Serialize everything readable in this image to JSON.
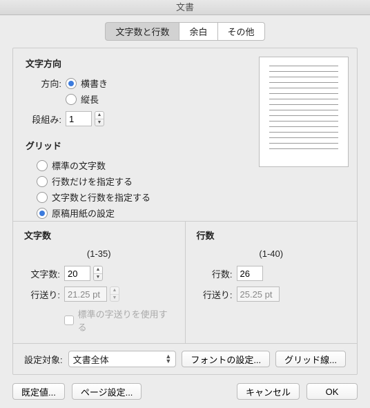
{
  "title": "文書",
  "tabs": {
    "t0": "文字数と行数",
    "t1": "余白",
    "t2": "その他"
  },
  "orientation": {
    "heading": "文字方向",
    "dir_label": "方向:",
    "horizontal": "横書き",
    "vertical": "縦長",
    "columns_label": "段組み:",
    "columns_value": "1"
  },
  "grid": {
    "heading": "グリッド",
    "opt0": "標準の文字数",
    "opt1": "行数だけを指定する",
    "opt2": "文字数と行数を指定する",
    "opt3": "原稿用紙の設定"
  },
  "chars": {
    "heading": "文字数",
    "range": "(1-35)",
    "count_label": "文字数:",
    "count_value": "20",
    "pitch_label": "行送り:",
    "pitch_value": "21.25 pt",
    "use_default": "標準の字送りを使用する"
  },
  "lines": {
    "heading": "行数",
    "range": "(1-40)",
    "count_label": "行数:",
    "count_value": "26",
    "pitch_label": "行送り:",
    "pitch_value": "25.25 pt"
  },
  "apply": {
    "label": "設定対象:",
    "value": "文書全体",
    "font_btn": "フォントの設定...",
    "grid_btn": "グリッド線..."
  },
  "footer": {
    "default": "既定値...",
    "page_setup": "ページ設定...",
    "cancel": "キャンセル",
    "ok": "OK"
  }
}
